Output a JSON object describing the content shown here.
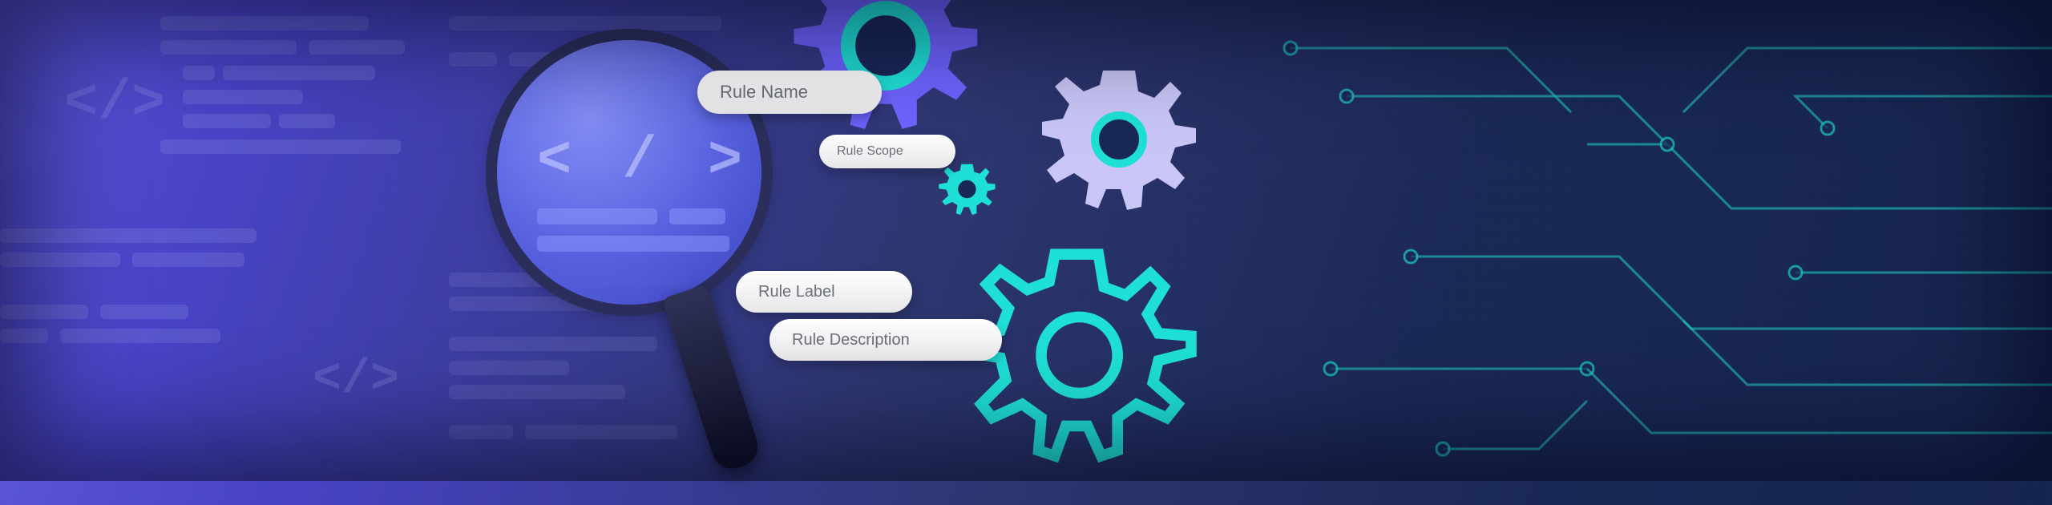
{
  "pills": {
    "name": "Rule Name",
    "scope": "Rule Scope",
    "label": "Rule Label",
    "description": "Rule Description"
  },
  "lens_glyph": "< / >",
  "colors": {
    "accent_teal": "#1fe0d6",
    "accent_purple": "#6f63ff",
    "accent_lavender": "#c9c5f6"
  }
}
